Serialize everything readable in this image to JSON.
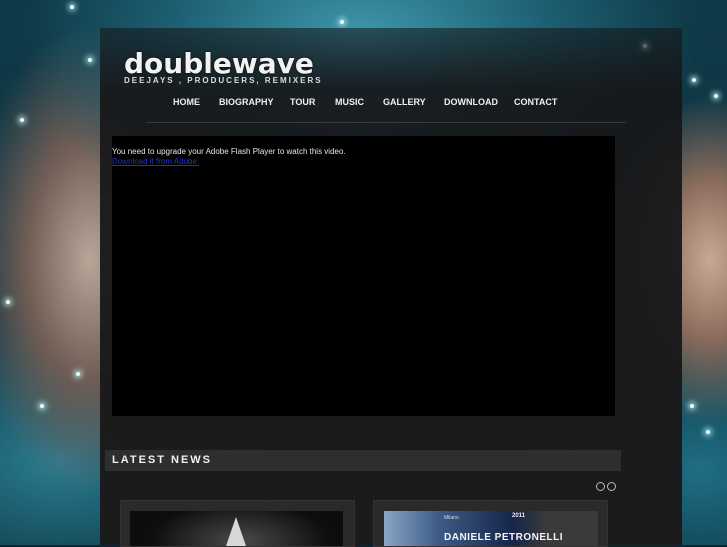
{
  "brand": {
    "logo_text": "doublewave",
    "tagline": "DEEJAYS , PRODUCERS, REMIXERS"
  },
  "nav": {
    "items": [
      {
        "label": "HOME"
      },
      {
        "label": "BIOGRAPHY"
      },
      {
        "label": "TOUR"
      },
      {
        "label": "MUSIC"
      },
      {
        "label": "GALLERY"
      },
      {
        "label": "DOWNLOAD"
      },
      {
        "label": "CONTACT"
      }
    ]
  },
  "video": {
    "message": "You need to upgrade your Adobe Flash Player to watch this video.",
    "link_text": "Download it from Adobe."
  },
  "news": {
    "heading": "LATEST NEWS",
    "cards": [
      {
        "image_alt": "news-image-1"
      },
      {
        "headline_text": "DANIELE PETRONELLI",
        "top_text": "Milano",
        "year_text": "2011"
      }
    ]
  },
  "colors": {
    "panel": "#1b1b1c",
    "nav_text": "#f0f0f0",
    "link": "#2233cc",
    "news_bar": "#2e2e2f"
  }
}
